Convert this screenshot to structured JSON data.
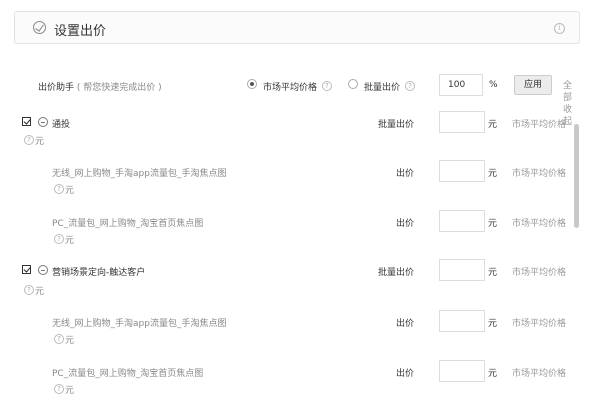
{
  "header": {
    "title": "设置出价",
    "info_glyph": "i"
  },
  "helper": {
    "label": "出价助手",
    "hint": "( 帮您快速完成出价 )",
    "option_market": "市场平均价格",
    "option_batch": "批量出价",
    "selected": "market",
    "percent_value": "100",
    "percent_sign": "%",
    "apply_label": "应用",
    "fold_label": "全部收起"
  },
  "groups": [
    {
      "name": "通投",
      "checked": true,
      "unit": "元",
      "batch_label": "批量出价",
      "yuan": "元",
      "market_label": "市场平均价格",
      "items": [
        {
          "name": "无线_网上购物_手淘app流量包_手淘焦点图",
          "bid_label": "出价",
          "yuan": "元",
          "market_label": "市场平均价格",
          "unit": "元"
        },
        {
          "name": "PC_流量包_网上购物_淘宝首页焦点图",
          "bid_label": "出价",
          "yuan": "元",
          "market_label": "市场平均价格",
          "unit": "元"
        }
      ]
    },
    {
      "name": "营销场景定向-触达客户",
      "checked": true,
      "unit": "元",
      "batch_label": "批量出价",
      "yuan": "元",
      "market_label": "市场平均价格",
      "items": [
        {
          "name": "无线_网上购物_手淘app流量包_手淘焦点图",
          "bid_label": "出价",
          "yuan": "元",
          "market_label": "市场平均价格",
          "unit": "元"
        },
        {
          "name": "PC_流量包_网上购物_淘宝首页焦点图",
          "bid_label": "出价",
          "yuan": "元",
          "market_label": "市场平均价格",
          "unit": "元"
        }
      ]
    }
  ],
  "question_glyph": "?"
}
